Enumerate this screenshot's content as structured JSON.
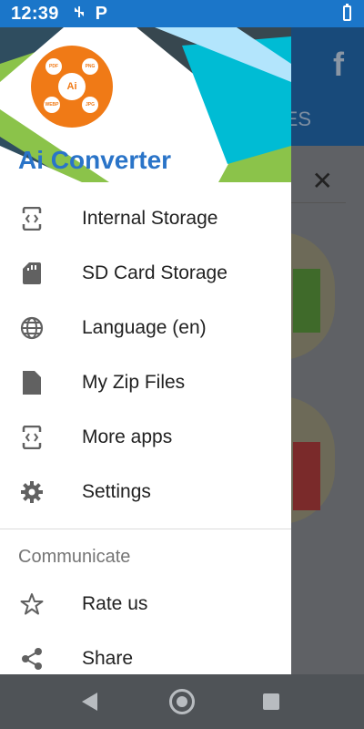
{
  "status_bar": {
    "time": "12:39",
    "p_icon": "P"
  },
  "background_app": {
    "tab_fragment": "ES",
    "fb": "f",
    "close": "✕"
  },
  "drawer": {
    "app_name": "Ai Converter",
    "logo": {
      "center": "Ai",
      "formats": [
        "PDF",
        "PNG",
        "WEBP",
        "JPG"
      ]
    },
    "items": [
      {
        "label": "Internal Storage",
        "icon": "phone-code-icon"
      },
      {
        "label": "SD Card Storage",
        "icon": "sd-card-icon"
      },
      {
        "label": "Language (en)",
        "icon": "globe-icon"
      },
      {
        "label": "My Zip Files",
        "icon": "file-icon"
      },
      {
        "label": "More apps",
        "icon": "phone-code-icon"
      },
      {
        "label": "Settings",
        "icon": "gear-icon"
      }
    ],
    "section": "Communicate",
    "section_items": [
      {
        "label": "Rate us",
        "icon": "star-icon"
      },
      {
        "label": "Share",
        "icon": "share-icon"
      }
    ]
  },
  "colors": {
    "status_bar": "#1b76c9",
    "logo": "#f07a16",
    "app_name": "#2a74c8"
  }
}
